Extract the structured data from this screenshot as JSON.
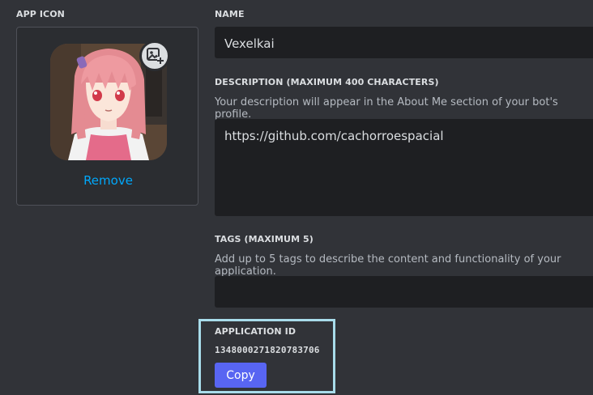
{
  "app_icon": {
    "label": "APP ICON",
    "remove_label": "Remove",
    "upload_badge_icon": "image-add-icon"
  },
  "name": {
    "label": "NAME",
    "value": "Vexelkai"
  },
  "description": {
    "label": "DESCRIPTION (MAXIMUM 400 CHARACTERS)",
    "helper": "Your description will appear in the About Me section of your bot's profile.",
    "value": "https://github.com/cachorroespacial"
  },
  "tags": {
    "label": "TAGS (MAXIMUM 5)",
    "helper": "Add up to 5 tags to describe the content and functionality of your application.",
    "value": ""
  },
  "application_id": {
    "label": "APPLICATION ID",
    "value": "1348000271820783706",
    "copy_label": "Copy"
  },
  "colors": {
    "background": "#313338",
    "input_bg": "#1e1f22",
    "accent": "#5865f2",
    "link": "#00a8fc",
    "highlight": "#a8dcea"
  }
}
